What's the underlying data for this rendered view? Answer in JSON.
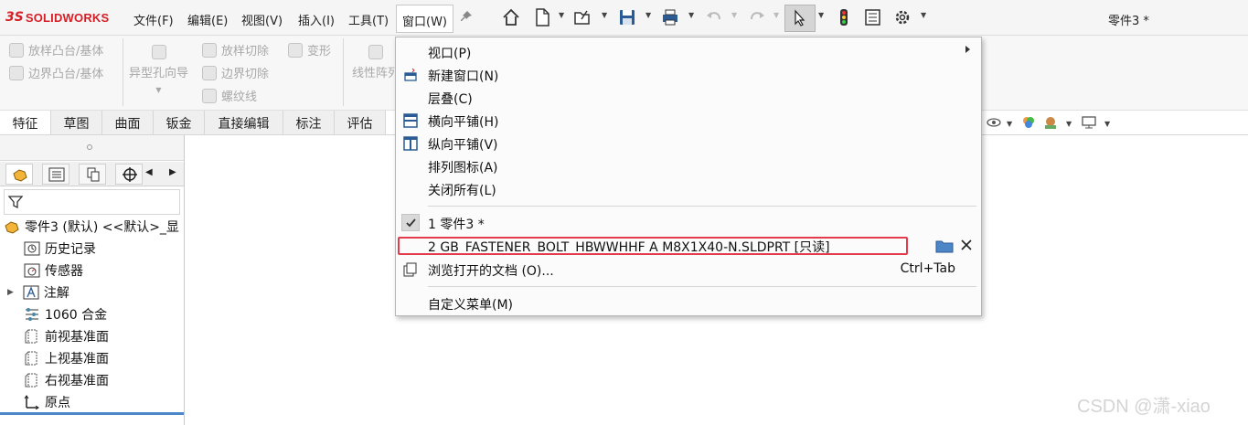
{
  "app": {
    "logo_prefix": "3S",
    "logo_text": "SOLIDWORKS",
    "document_title": "零件3 *"
  },
  "menubar": {
    "items": [
      "文件(F)",
      "编辑(E)",
      "视图(V)",
      "插入(I)",
      "工具(T)",
      "窗口(W)"
    ],
    "open_item": "窗口(W)"
  },
  "toolbar_icons": [
    "home-icon",
    "new-doc-icon",
    "open-icon",
    "save-icon",
    "print-icon",
    "undo-icon",
    "redo-icon",
    "select-arrow-icon",
    "traffic-light-icon",
    "file-properties-icon",
    "gear-icon"
  ],
  "command_manager": {
    "buttons": [
      "放样凸台/基体",
      "边界凸台/基体",
      "异型孔向导",
      "放样切除",
      "边界切除",
      "螺纹线",
      "变形",
      "线性阵列"
    ]
  },
  "tabs": [
    "特征",
    "草图",
    "曲面",
    "钣金",
    "直接编辑",
    "标注",
    "评估"
  ],
  "feature_tree": {
    "root": "零件3 (默认) <<默认>_显",
    "items": [
      {
        "label": "历史记录",
        "icon": "history-icon"
      },
      {
        "label": "传感器",
        "icon": "sensor-icon"
      },
      {
        "label": "注解",
        "icon": "annotation-icon",
        "expandable": true
      },
      {
        "label": "1060 合金",
        "icon": "material-icon"
      },
      {
        "label": "前视基准面",
        "icon": "plane-icon"
      },
      {
        "label": "上视基准面",
        "icon": "plane-icon"
      },
      {
        "label": "右视基准面",
        "icon": "plane-icon"
      },
      {
        "label": "原点",
        "icon": "origin-icon"
      }
    ]
  },
  "window_menu": {
    "items": [
      {
        "label": "视口(P)",
        "icon": "",
        "submenu": true
      },
      {
        "label": "新建窗口(N)",
        "icon": "new-window-icon"
      },
      {
        "label": "层叠(C)",
        "icon": ""
      },
      {
        "label": "横向平铺(H)",
        "icon": "tile-horizontal-icon"
      },
      {
        "label": "纵向平铺(V)",
        "icon": "tile-vertical-icon"
      },
      {
        "label": "排列图标(A)",
        "icon": ""
      },
      {
        "label": "关闭所有(L)",
        "icon": ""
      }
    ],
    "open_docs": [
      {
        "label": "1 零件3 *",
        "checked": true
      },
      {
        "label": "2 GB_FASTENER_BOLT_HBWWHHF A M8X1X40-N.SLDPRT [只读]",
        "checked": false,
        "highlighted": true
      }
    ],
    "browse": {
      "label": "浏览打开的文档 (O)...",
      "shortcut": "Ctrl+Tab"
    },
    "customize": {
      "label": "自定义菜单(M)"
    }
  },
  "watermark": "CSDN @潇-xiao",
  "colors": {
    "highlight_border": "#e33b4c",
    "logo_red": "#d51f26",
    "selection_bar": "#4a86c8"
  }
}
